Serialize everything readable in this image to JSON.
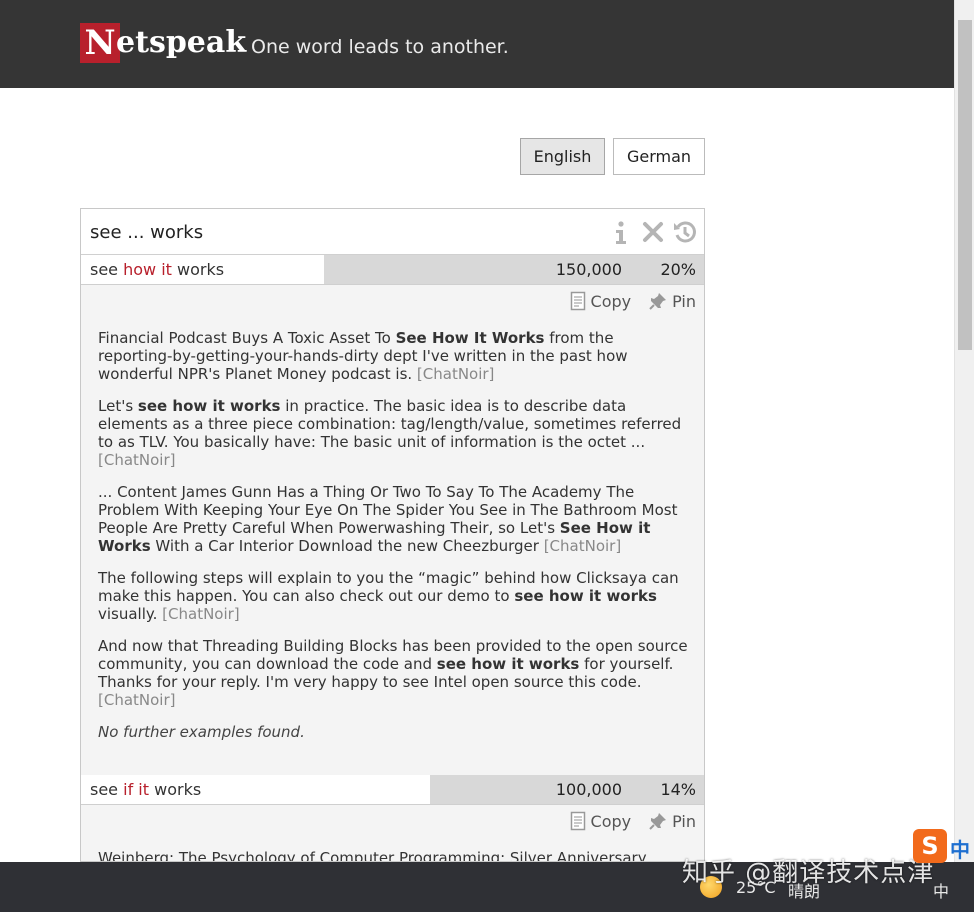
{
  "header": {
    "logo_first": "N",
    "logo_rest": "etspeak",
    "tagline": "One word leads to another."
  },
  "languages": [
    {
      "label": "English",
      "active": true
    },
    {
      "label": "German",
      "active": false
    }
  ],
  "search": {
    "query": "see ... works",
    "icons": [
      "info-icon",
      "clear-icon",
      "history-icon"
    ]
  },
  "results": [
    {
      "prefix": "see",
      "wild1": "how",
      "wild2": "it",
      "suffix": "works",
      "frequency": "150,000",
      "percent": "20%",
      "share": 0.39,
      "copy_label": "Copy",
      "pin_label": "Pin",
      "examples": [
        {
          "before": "Financial Podcast Buys A Toxic Asset To ",
          "match": "See How It Works",
          "after": " from the reporting-by-getting-your-hands-dirty dept I've written in the past how wonderful NPR's Planet Money podcast is. ",
          "source": "[ChatNoir]"
        },
        {
          "before": "Let's ",
          "match": "see how it works",
          "after": " in practice. The basic idea is to describe data elements as a three piece combination: tag/length/value, sometimes referred to as TLV. You basically have: The basic unit of information is the octet ... ",
          "source": "[ChatNoir]"
        },
        {
          "before": "... Content James Gunn Has a Thing Or Two To Say To The Academy The Problem With Keeping Your Eye On The Spider You See in The Bathroom Most People Are Pretty Careful When Powerwashing Their, so Let's ",
          "match": "See How it Works",
          "after": " With a Car Interior Download the new Cheezburger ",
          "source": "[ChatNoir]"
        },
        {
          "before": "The following steps will explain to you the “magic” behind how Clicksaya can make this happen. You can also check out our demo to ",
          "match": "see how it works",
          "after": " visually. ",
          "source": "[ChatNoir]"
        },
        {
          "before": "And now that Threading Building Blocks has been provided to the open source community, you can download the code and ",
          "match": "see how it works",
          "after": " for yourself. Thanks for your reply. I'm very happy to see Intel open source this code. ",
          "source": "[ChatNoir]"
        }
      ],
      "no_further": "No further examples found."
    },
    {
      "prefix": "see",
      "wild1": "if",
      "wild2": "it",
      "suffix": "works",
      "frequency": "100,000",
      "percent": "14%",
      "share": 0.56,
      "copy_label": "Copy",
      "pin_label": "Pin",
      "partial_example": "Weinberg: The Psychology of Computer Programming: Silver Anniversary"
    }
  ],
  "taskbar": {
    "temperature": "25°C",
    "weather": "晴朗",
    "ime": "中",
    "watermark": "知乎 @翻译技术点津"
  }
}
